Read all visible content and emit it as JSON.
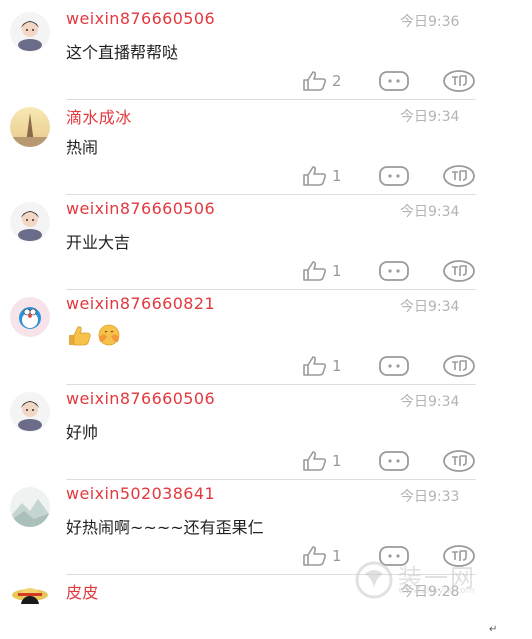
{
  "comments": [
    {
      "avatar": "girl-cartoon-avatar",
      "username": "weixin876660506",
      "time": "今日9:36",
      "content": "这个直播帮帮哒",
      "likes": "2"
    },
    {
      "avatar": "tower-photo-avatar",
      "username": "滴水成冰",
      "time": "今日9:34",
      "content": "热闹",
      "likes": "1"
    },
    {
      "avatar": "girl-cartoon-avatar",
      "username": "weixin876660506",
      "time": "今日9:34",
      "content": "开业大吉",
      "likes": "1"
    },
    {
      "avatar": "doraemon-avatar",
      "username": "weixin876660821",
      "time": "今日9:34",
      "content": "",
      "content_emojis": [
        "thumbs-up-emoji",
        "clapping-face-emoji"
      ],
      "likes": "1"
    },
    {
      "avatar": "girl-cartoon-avatar",
      "username": "weixin876660506",
      "time": "今日9:34",
      "content": "好帅",
      "likes": "1"
    },
    {
      "avatar": "mountain-landscape-avatar",
      "username": "weixin502038641",
      "time": "今日9:33",
      "content": "好热闹啊~~~~还有歪果仁",
      "likes": "1"
    },
    {
      "avatar": "pirate-straw-hat-avatar",
      "username": "皮皮",
      "time": "今日9:28"
    }
  ],
  "watermark": {
    "text": "装一网",
    "url": "www.zhuyiw.com",
    "icon": "zhuyi-logo-icon"
  },
  "return_mark": "↵",
  "colors": {
    "username": "#e2393f",
    "time": "#b3b3b3",
    "icon": "#9a9a9a",
    "divider": "#dddddd",
    "content": "#222222"
  }
}
